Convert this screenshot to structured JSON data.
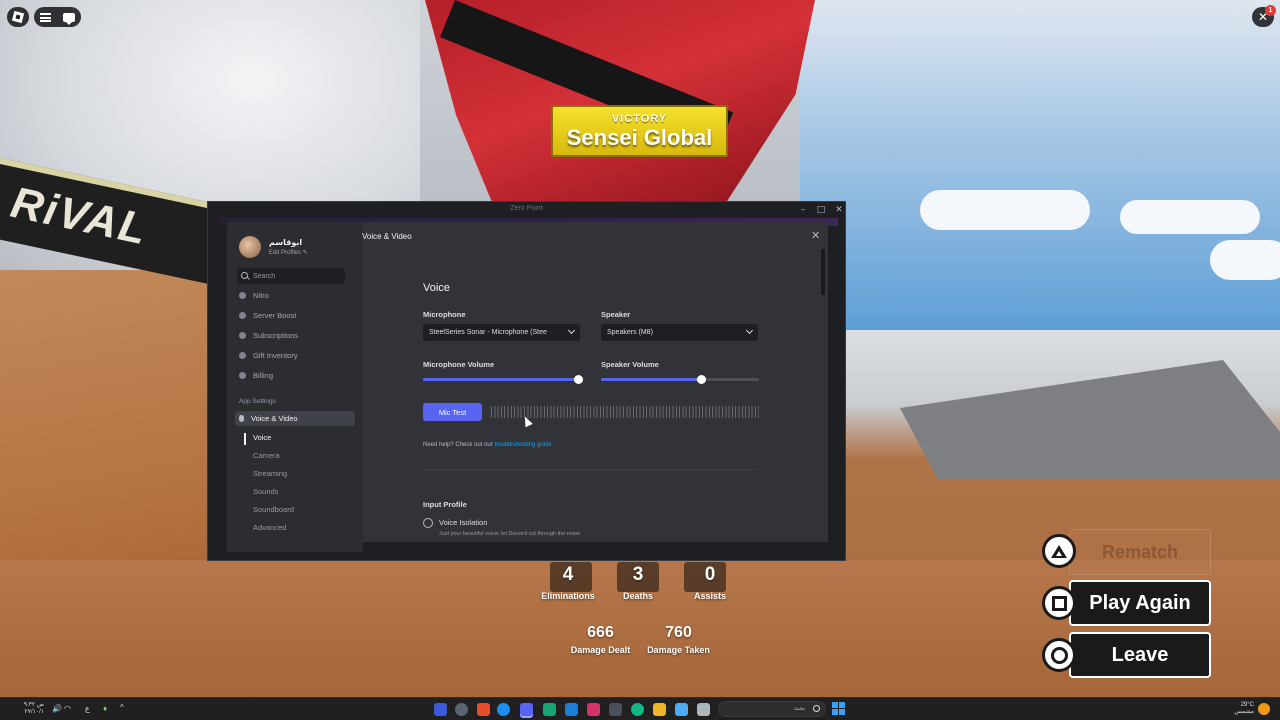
{
  "game": {
    "victory_label": "VICTORY",
    "winner_name": "Sensei Global",
    "banner_text": "RiVAL",
    "stats": [
      {
        "value": "4",
        "label": "Eliminations"
      },
      {
        "value": "3",
        "label": "Deaths"
      },
      {
        "value": "0",
        "label": "Assists"
      }
    ],
    "damage": [
      {
        "value": "666",
        "label": "Damage Dealt"
      },
      {
        "value": "760",
        "label": "Damage Taken"
      }
    ],
    "buttons": {
      "rematch": "Rematch",
      "play_again": "Play Again",
      "leave": "Leave"
    },
    "notification_count": "1"
  },
  "discord": {
    "window_title": "Zero Point",
    "profile": {
      "name": "ابوقاسم",
      "edit_label": "Edit Profiles ✎"
    },
    "search_placeholder": "Search",
    "nav_items": [
      {
        "label": "Nitro"
      },
      {
        "label": "Server Boost"
      },
      {
        "label": "Subscriptions"
      },
      {
        "label": "Gift Inventory"
      },
      {
        "label": "Billing"
      }
    ],
    "app_settings_header": "App Settings",
    "active_item": "Voice & Video",
    "sub_items": [
      "Voice",
      "Camera",
      "Streaming",
      "Sounds",
      "Soundboard",
      "Advanced"
    ],
    "content": {
      "page_title": "Voice & Video",
      "section_title": "Voice",
      "microphone_label": "Microphone",
      "microphone_value": "SteelSeries Sonar - Microphone (Stee",
      "speaker_label": "Speaker",
      "speaker_value": "Speakers (M8)",
      "mic_volume_label": "Microphone Volume",
      "mic_volume": 0.98,
      "speaker_volume_label": "Speaker Volume",
      "speaker_volume": 0.63,
      "mic_test_label": "Mic Test",
      "help_text": "Need help? Check out our ",
      "help_link": "troubleshooting guide.",
      "input_profile_label": "Input Profile",
      "option_name": "Voice Isolation",
      "option_desc": "Just your beautiful voice: let Discord cut through the noise"
    }
  },
  "taskbar": {
    "clock_time": "۹:۳۲ ص",
    "clock_date": "۲۷/۱۰/۱",
    "lang": "ع",
    "search_text": "بحث",
    "weather_temp": "29°C",
    "weather_text": "مشمس"
  }
}
